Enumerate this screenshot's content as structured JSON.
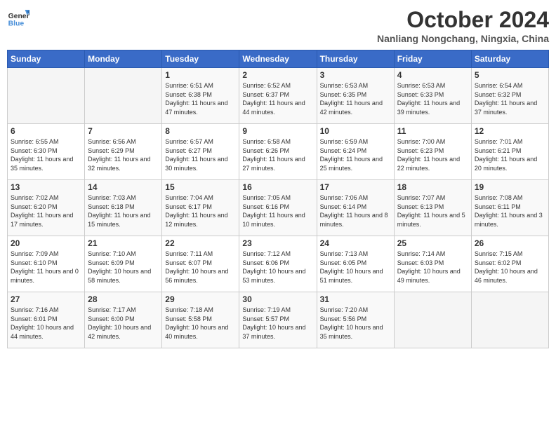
{
  "header": {
    "logo_line1": "General",
    "logo_line2": "Blue",
    "month": "October 2024",
    "location": "Nanliang Nongchang, Ningxia, China"
  },
  "days_of_week": [
    "Sunday",
    "Monday",
    "Tuesday",
    "Wednesday",
    "Thursday",
    "Friday",
    "Saturday"
  ],
  "weeks": [
    [
      {
        "day": "",
        "info": ""
      },
      {
        "day": "",
        "info": ""
      },
      {
        "day": "1",
        "info": "Sunrise: 6:51 AM\nSunset: 6:38 PM\nDaylight: 11 hours and 47 minutes."
      },
      {
        "day": "2",
        "info": "Sunrise: 6:52 AM\nSunset: 6:37 PM\nDaylight: 11 hours and 44 minutes."
      },
      {
        "day": "3",
        "info": "Sunrise: 6:53 AM\nSunset: 6:35 PM\nDaylight: 11 hours and 42 minutes."
      },
      {
        "day": "4",
        "info": "Sunrise: 6:53 AM\nSunset: 6:33 PM\nDaylight: 11 hours and 39 minutes."
      },
      {
        "day": "5",
        "info": "Sunrise: 6:54 AM\nSunset: 6:32 PM\nDaylight: 11 hours and 37 minutes."
      }
    ],
    [
      {
        "day": "6",
        "info": "Sunrise: 6:55 AM\nSunset: 6:30 PM\nDaylight: 11 hours and 35 minutes."
      },
      {
        "day": "7",
        "info": "Sunrise: 6:56 AM\nSunset: 6:29 PM\nDaylight: 11 hours and 32 minutes."
      },
      {
        "day": "8",
        "info": "Sunrise: 6:57 AM\nSunset: 6:27 PM\nDaylight: 11 hours and 30 minutes."
      },
      {
        "day": "9",
        "info": "Sunrise: 6:58 AM\nSunset: 6:26 PM\nDaylight: 11 hours and 27 minutes."
      },
      {
        "day": "10",
        "info": "Sunrise: 6:59 AM\nSunset: 6:24 PM\nDaylight: 11 hours and 25 minutes."
      },
      {
        "day": "11",
        "info": "Sunrise: 7:00 AM\nSunset: 6:23 PM\nDaylight: 11 hours and 22 minutes."
      },
      {
        "day": "12",
        "info": "Sunrise: 7:01 AM\nSunset: 6:21 PM\nDaylight: 11 hours and 20 minutes."
      }
    ],
    [
      {
        "day": "13",
        "info": "Sunrise: 7:02 AM\nSunset: 6:20 PM\nDaylight: 11 hours and 17 minutes."
      },
      {
        "day": "14",
        "info": "Sunrise: 7:03 AM\nSunset: 6:18 PM\nDaylight: 11 hours and 15 minutes."
      },
      {
        "day": "15",
        "info": "Sunrise: 7:04 AM\nSunset: 6:17 PM\nDaylight: 11 hours and 12 minutes."
      },
      {
        "day": "16",
        "info": "Sunrise: 7:05 AM\nSunset: 6:16 PM\nDaylight: 11 hours and 10 minutes."
      },
      {
        "day": "17",
        "info": "Sunrise: 7:06 AM\nSunset: 6:14 PM\nDaylight: 11 hours and 8 minutes."
      },
      {
        "day": "18",
        "info": "Sunrise: 7:07 AM\nSunset: 6:13 PM\nDaylight: 11 hours and 5 minutes."
      },
      {
        "day": "19",
        "info": "Sunrise: 7:08 AM\nSunset: 6:11 PM\nDaylight: 11 hours and 3 minutes."
      }
    ],
    [
      {
        "day": "20",
        "info": "Sunrise: 7:09 AM\nSunset: 6:10 PM\nDaylight: 11 hours and 0 minutes."
      },
      {
        "day": "21",
        "info": "Sunrise: 7:10 AM\nSunset: 6:09 PM\nDaylight: 10 hours and 58 minutes."
      },
      {
        "day": "22",
        "info": "Sunrise: 7:11 AM\nSunset: 6:07 PM\nDaylight: 10 hours and 56 minutes."
      },
      {
        "day": "23",
        "info": "Sunrise: 7:12 AM\nSunset: 6:06 PM\nDaylight: 10 hours and 53 minutes."
      },
      {
        "day": "24",
        "info": "Sunrise: 7:13 AM\nSunset: 6:05 PM\nDaylight: 10 hours and 51 minutes."
      },
      {
        "day": "25",
        "info": "Sunrise: 7:14 AM\nSunset: 6:03 PM\nDaylight: 10 hours and 49 minutes."
      },
      {
        "day": "26",
        "info": "Sunrise: 7:15 AM\nSunset: 6:02 PM\nDaylight: 10 hours and 46 minutes."
      }
    ],
    [
      {
        "day": "27",
        "info": "Sunrise: 7:16 AM\nSunset: 6:01 PM\nDaylight: 10 hours and 44 minutes."
      },
      {
        "day": "28",
        "info": "Sunrise: 7:17 AM\nSunset: 6:00 PM\nDaylight: 10 hours and 42 minutes."
      },
      {
        "day": "29",
        "info": "Sunrise: 7:18 AM\nSunset: 5:58 PM\nDaylight: 10 hours and 40 minutes."
      },
      {
        "day": "30",
        "info": "Sunrise: 7:19 AM\nSunset: 5:57 PM\nDaylight: 10 hours and 37 minutes."
      },
      {
        "day": "31",
        "info": "Sunrise: 7:20 AM\nSunset: 5:56 PM\nDaylight: 10 hours and 35 minutes."
      },
      {
        "day": "",
        "info": ""
      },
      {
        "day": "",
        "info": ""
      }
    ]
  ]
}
